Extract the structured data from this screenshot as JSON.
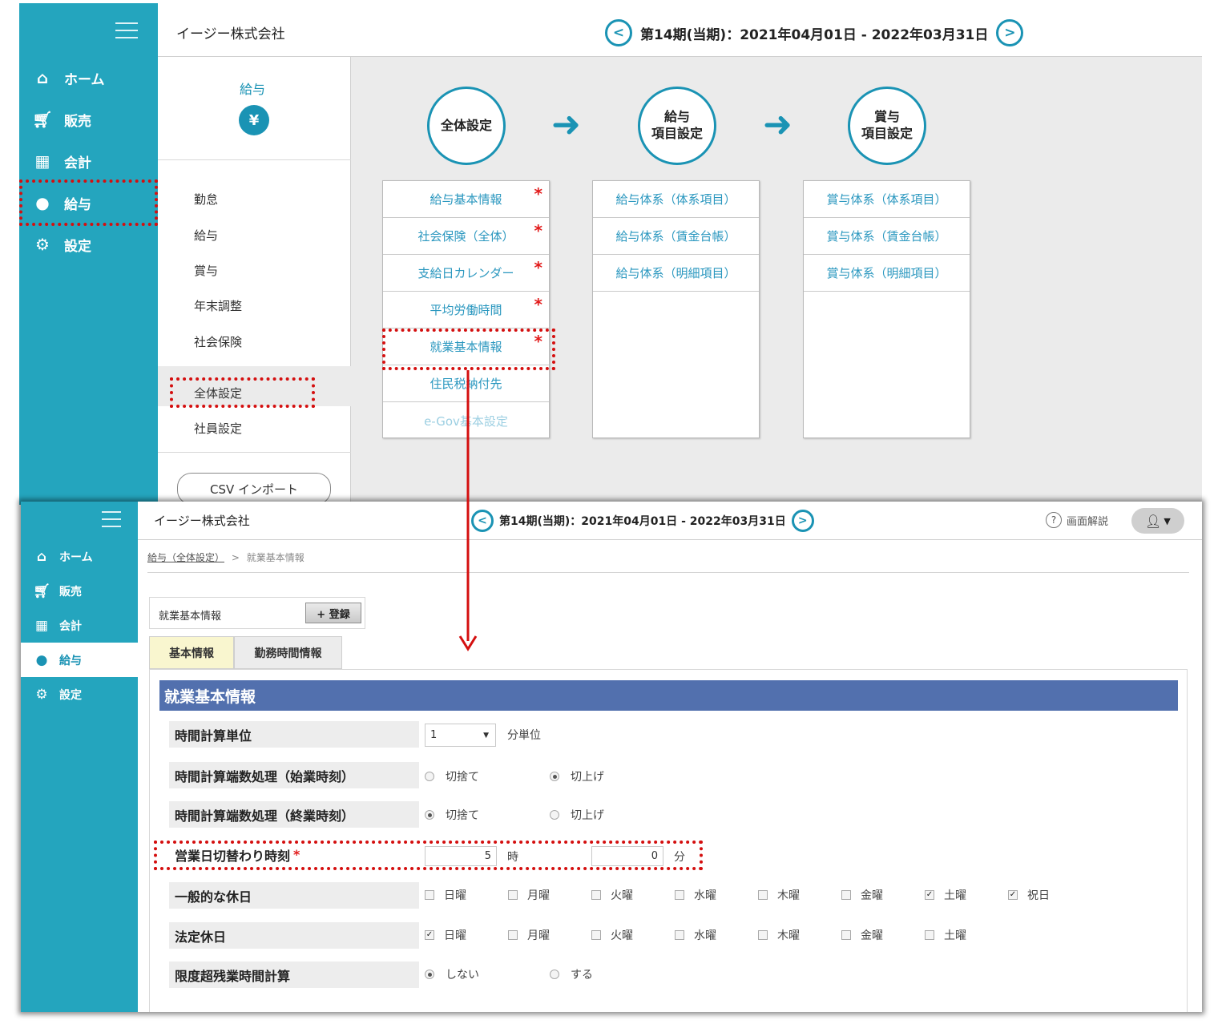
{
  "top": {
    "nav": [
      {
        "icon": "home-icon",
        "label": "ホーム"
      },
      {
        "icon": "cart-icon",
        "label": "販売"
      },
      {
        "icon": "calculator-icon",
        "label": "会計"
      },
      {
        "icon": "money-bag-icon",
        "label": "給与"
      },
      {
        "icon": "gear-icon",
        "label": "設定"
      }
    ],
    "company": "イージー株式会社",
    "period": "第14期(当期)：2021年04月01日 - 2022年03月31日",
    "submenu_title": "給与",
    "submenu_items": [
      "勤怠",
      "給与",
      "賞与",
      "年末調整",
      "社会保険",
      "全体設定",
      "社員設定"
    ],
    "csv_import": "CSV インポート",
    "flow": {
      "step1": "全体設定",
      "step2_line1": "給与",
      "step2_line2": "項目設定",
      "step3_line1": "賞与",
      "step3_line2": "項目設定"
    },
    "col1": [
      "給与基本情報",
      "社会保険（全体）",
      "支給日カレンダー",
      "平均労働時間",
      "就業基本情報",
      "住民税納付先",
      "e-Gov基本設定"
    ],
    "col2": [
      "給与体系（体系項目）",
      "給与体系（賃金台帳）",
      "給与体系（明細項目）"
    ],
    "col3": [
      "賞与体系（体系項目）",
      "賞与体系（賃金台帳）",
      "賞与体系（明細項目）"
    ],
    "required_mark": "*"
  },
  "bottom": {
    "nav": [
      {
        "icon": "home-icon",
        "label": "ホーム"
      },
      {
        "icon": "cart-icon",
        "label": "販売"
      },
      {
        "icon": "calculator-icon",
        "label": "会計"
      },
      {
        "icon": "money-bag-icon",
        "label": "給与"
      },
      {
        "icon": "gear-icon",
        "label": "設定"
      }
    ],
    "company": "イージー株式会社",
    "period": "第14期(当期)：2021年04月01日 - 2022年03月31日",
    "help": "画面解説",
    "breadcrumb_link": "給与（全体設定）",
    "breadcrumb_sep": ">",
    "breadcrumb_current": "就業基本情報",
    "panel_label": "就業基本情報",
    "register_button": "+ 登録",
    "tabs": [
      "基本情報",
      "勤務時間情報"
    ],
    "section_title": "就業基本情報",
    "fields": {
      "time_unit_label": "時間計算単位",
      "time_unit_value": "1",
      "time_unit_suffix": "分単位",
      "start_rounding_label": "時間計算端数処理（始業時刻）",
      "end_rounding_label": "時間計算端数処理（終業時刻）",
      "round_down": "切捨て",
      "round_up": "切上げ",
      "switch_time_label": "営業日切替わり時刻",
      "switch_hour": "5",
      "hour_unit": "時",
      "switch_minute": "0",
      "minute_unit": "分",
      "holiday_label": "一般的な休日",
      "legal_holiday_label": "法定休日",
      "overtime_label": "限度超残業時間計算",
      "overtime_no": "しない",
      "overtime_yes": "する"
    },
    "days": [
      "日曜",
      "月曜",
      "火曜",
      "水曜",
      "木曜",
      "金曜",
      "土曜",
      "祝日"
    ],
    "general_holidays_checked": [
      false,
      false,
      false,
      false,
      false,
      false,
      true,
      true
    ],
    "legal_holidays_checked": [
      true,
      false,
      false,
      false,
      false,
      false,
      false
    ]
  },
  "colors": {
    "sidebar": "#24a5be",
    "accent": "#1a93b4",
    "section_header": "#5270ae",
    "highlight_dash": "#d40f0f",
    "required": "#e21b1b"
  }
}
